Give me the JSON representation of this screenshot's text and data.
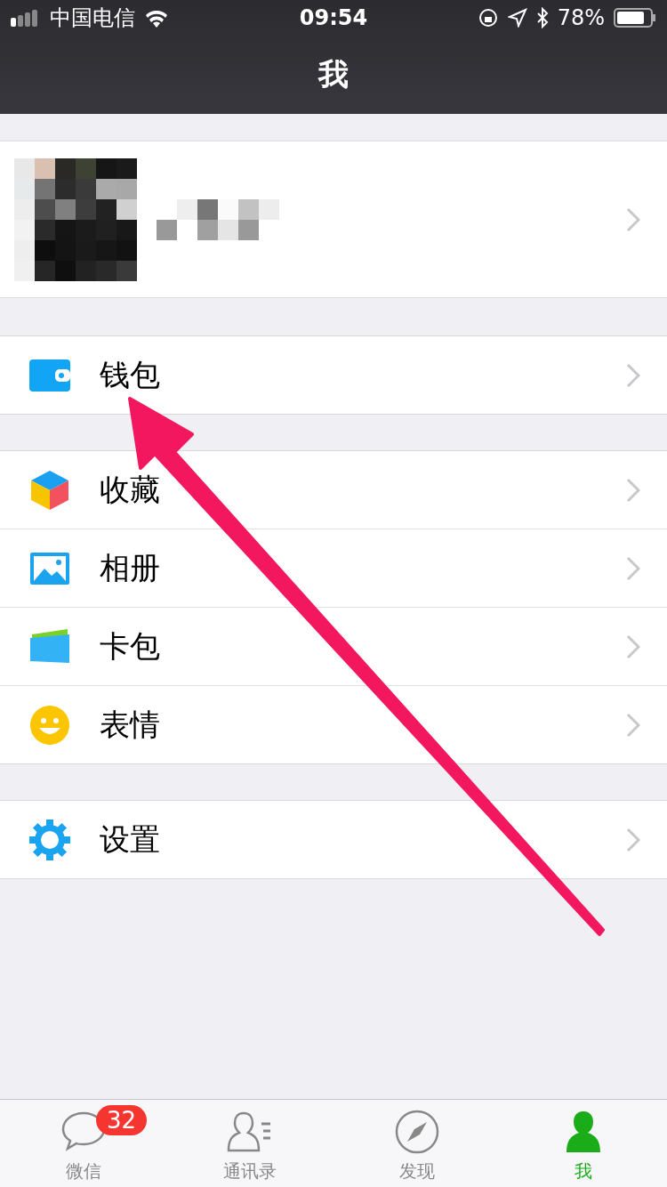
{
  "status_bar": {
    "carrier": "中国电信",
    "time": "09:54",
    "battery": "78%"
  },
  "nav": {
    "title": "我"
  },
  "sections": [
    {
      "items": [
        {
          "label": "钱包",
          "kind": "wallet"
        }
      ]
    },
    {
      "items": [
        {
          "label": "收藏",
          "kind": "favorites"
        },
        {
          "label": "相册",
          "kind": "album"
        },
        {
          "label": "卡包",
          "kind": "cards"
        },
        {
          "label": "表情",
          "kind": "sticker"
        }
      ]
    },
    {
      "items": [
        {
          "label": "设置",
          "kind": "settings"
        }
      ]
    }
  ],
  "tabs": [
    {
      "label": "微信",
      "kind": "chat",
      "badge": "32",
      "selected": false
    },
    {
      "label": "通讯录",
      "kind": "contacts",
      "selected": false
    },
    {
      "label": "发现",
      "kind": "discover",
      "selected": false
    },
    {
      "label": "我",
      "kind": "me",
      "selected": true
    }
  ]
}
